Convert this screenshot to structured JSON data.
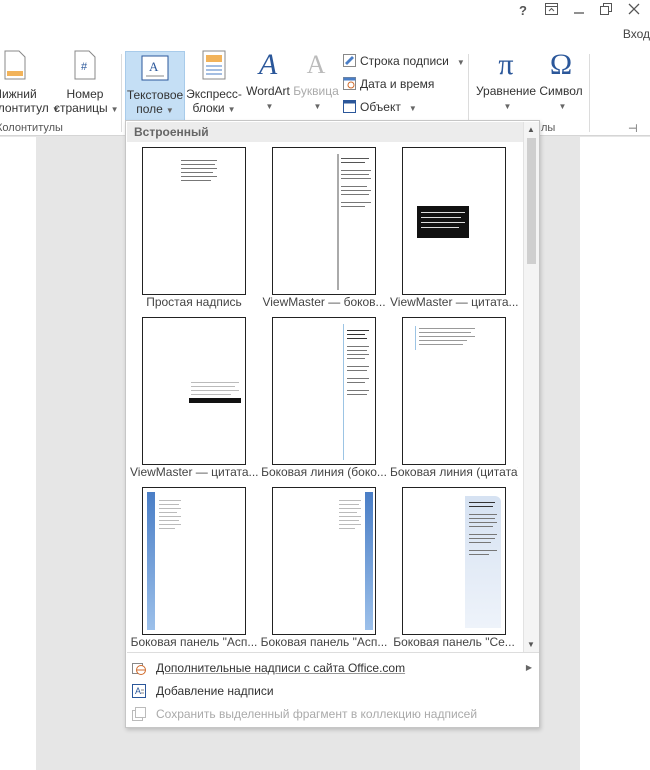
{
  "titlebar": {
    "help": "?",
    "login": "Вход"
  },
  "ribbon": {
    "footer": {
      "line1": "Нижний",
      "line2": "колонтитул"
    },
    "page_number": {
      "line1": "Номер",
      "line2": "страницы"
    },
    "group_headers_footers": "Колонтитулы",
    "text_box": {
      "line1": "Текстовое",
      "line2": "поле"
    },
    "quick_parts": {
      "line1": "Экспресс-",
      "line2": "блоки"
    },
    "wordart": "WordArt",
    "dropcap": "Буквица",
    "signature_line": "Строка подписи",
    "date_time": "Дата и время",
    "object": "Объект",
    "equation": "Уравнение",
    "symbol": "Символ",
    "group_symbols_tail": "лы"
  },
  "gallery": {
    "header": "Встроенный",
    "items": [
      {
        "caption": "Простая надпись"
      },
      {
        "caption": "ViewMaster — боков..."
      },
      {
        "caption": "ViewMaster — цитата..."
      },
      {
        "caption": "ViewMaster — цитата..."
      },
      {
        "caption": "Боковая линия (боко..."
      },
      {
        "caption": "Боковая линия (цитата)"
      },
      {
        "caption": "Боковая панель \"Асп..."
      },
      {
        "caption": "Боковая панель \"Асп..."
      },
      {
        "caption": "Боковая панель \"Се..."
      }
    ],
    "menu": {
      "more_from_office": "Дополнительные надписи с сайта Office.com",
      "add_text_box": "Добавление надписи",
      "save_selection": "Сохранить выделенный фрагмент в коллекцию надписей"
    }
  },
  "colors": {
    "accent_blue": "#2b579a",
    "selected_bg": "#c5dff5",
    "aspect_blue": "#4a7ec6"
  }
}
